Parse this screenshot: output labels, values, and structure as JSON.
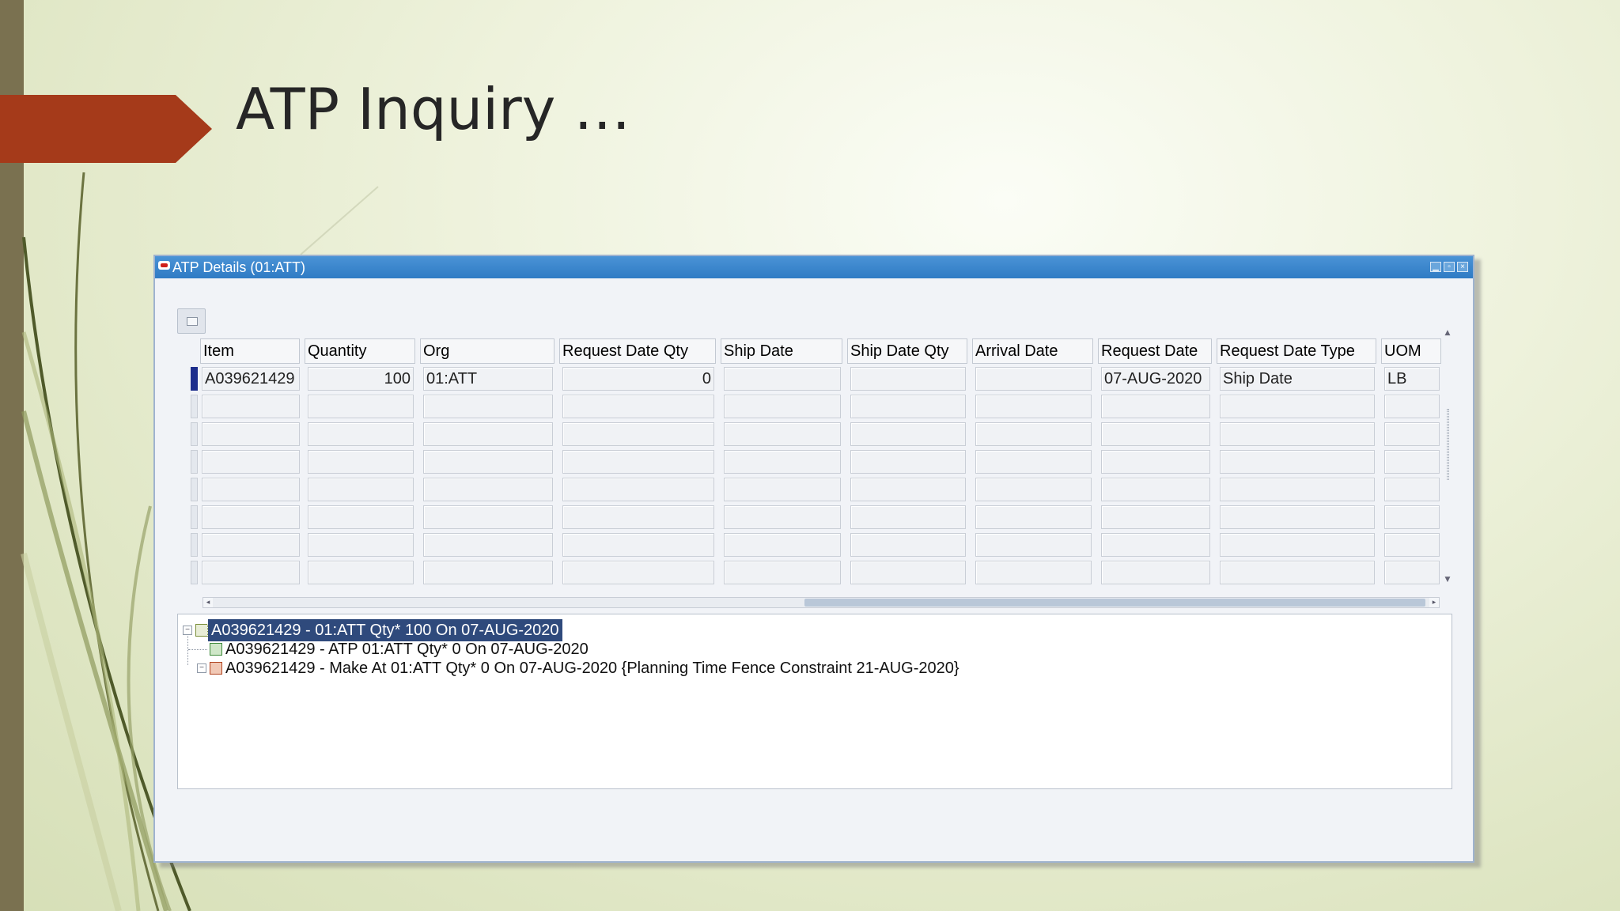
{
  "slide": {
    "title": "ATP Inquiry …"
  },
  "window": {
    "title": "ATP Details (01:ATT)",
    "controls": [
      "minimize",
      "maximize",
      "close"
    ]
  },
  "grid": {
    "columns": [
      {
        "key": "item",
        "label": "Item"
      },
      {
        "key": "quantity",
        "label": "Quantity"
      },
      {
        "key": "org",
        "label": "Org"
      },
      {
        "key": "request_date_qty",
        "label": "Request Date Qty"
      },
      {
        "key": "ship_date",
        "label": "Ship Date"
      },
      {
        "key": "ship_date_qty",
        "label": "Ship Date Qty"
      },
      {
        "key": "arrival_date",
        "label": "Arrival Date"
      },
      {
        "key": "request_date",
        "label": "Request Date"
      },
      {
        "key": "request_date_type",
        "label": "Request Date Type"
      },
      {
        "key": "uom",
        "label": "UOM"
      }
    ],
    "rows": [
      [
        "A039621429",
        "100",
        "01:ATT",
        "0",
        "",
        "",
        "",
        "07-AUG-2020",
        "Ship Date",
        "LB"
      ],
      [
        "",
        "",
        "",
        "",
        "",
        "",
        "",
        "",
        "",
        ""
      ],
      [
        "",
        "",
        "",
        "",
        "",
        "",
        "",
        "",
        "",
        ""
      ],
      [
        "",
        "",
        "",
        "",
        "",
        "",
        "",
        "",
        "",
        ""
      ],
      [
        "",
        "",
        "",
        "",
        "",
        "",
        "",
        "",
        "",
        ""
      ],
      [
        "",
        "",
        "",
        "",
        "",
        "",
        "",
        "",
        "",
        ""
      ],
      [
        "",
        "",
        "",
        "",
        "",
        "",
        "",
        "",
        "",
        ""
      ],
      [
        "",
        "",
        "",
        "",
        "",
        "",
        "",
        "",
        "",
        ""
      ]
    ],
    "numeric_columns": [
      "quantity",
      "request_date_qty"
    ]
  },
  "tree": {
    "nodes": [
      {
        "label": "A039621429 -  01:ATT  Qty* 100 On 07-AUG-2020",
        "selected": true,
        "icon": "item-icon"
      },
      {
        "label": "A039621429 - ATP 01:ATT  Qty* 0 On 07-AUG-2020",
        "selected": false,
        "icon": "atp-supply-icon"
      },
      {
        "label": "A039621429 - Make At 01:ATT  Qty* 0 On 07-AUG-2020 {Planning Time Fence Constraint 21-AUG-2020}",
        "selected": false,
        "icon": "make-icon"
      }
    ]
  },
  "colors": {
    "title_arrow": "#a53a1a",
    "titlebar": "#2f7bc4",
    "selection": "#2f4a7c",
    "record_indicator": "#1d2e8c"
  }
}
